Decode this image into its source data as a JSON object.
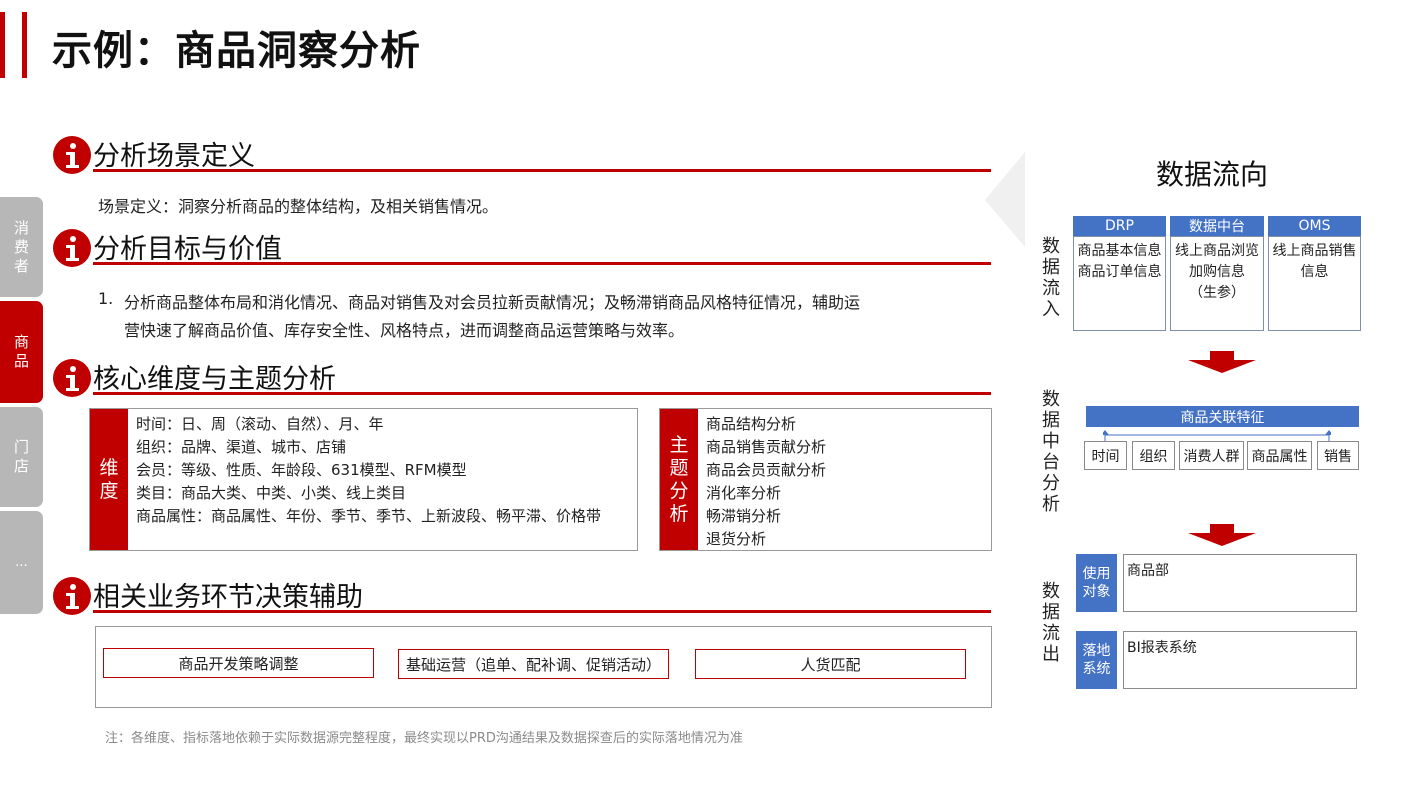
{
  "header": {
    "title": "示例：商品洞察分析"
  },
  "side_tabs": [
    "消费者",
    "商品",
    "门店",
    "..."
  ],
  "sections": {
    "scene": {
      "title": "分析场景定义",
      "text": "场景定义：洞察分析商品的整体结构，及相关销售情况。"
    },
    "goal": {
      "title": "分析目标与价值",
      "num": "1.",
      "line1": "分析商品整体布局和消化情况、商品对销售及对会员拉新贡献情况；及畅滞销商品风格特征情况，辅助运",
      "line2": "营快速了解商品价值、库存安全性、风格特点，进而调整商品运营策略与效率。"
    },
    "core": {
      "title": "核心维度与主题分析",
      "dim_label": "维度",
      "dims": [
        "时间：日、周（滚动、自然）、月、年",
        "组织：品牌、渠道、城市、店铺",
        "会员：等级、性质、年龄段、631模型、RFM模型",
        "类目：商品大类、中类、小类、线上类目",
        "商品属性：商品属性、年份、季节、季节、上新波段、畅平滞、价格带"
      ],
      "topic_label": "主题分析",
      "topics": [
        "商品结构分析",
        "商品销售贡献分析",
        "商品会员贡献分析",
        "消化率分析",
        "畅滞销分析",
        "退货分析"
      ]
    },
    "decision": {
      "title": "相关业务环节决策辅助",
      "items": [
        "商品开发策略调整",
        "基础运营（追单、配补调、促销活动）",
        "人货匹配"
      ]
    }
  },
  "note": "注：各维度、指标落地依赖于实际数据源完整程度，最终实现以PRD沟通结果及数据探查后的实际落地情况为准",
  "flow": {
    "title": "数据流向",
    "inflow_label": "数据流入",
    "sources": [
      {
        "name": "DRP",
        "lines": [
          "商品基本信息",
          "商品订单信息"
        ]
      },
      {
        "name": "数据中台",
        "lines": [
          "线上商品浏览",
          "加购信息",
          "（生参）"
        ]
      },
      {
        "name": "OMS",
        "lines": [
          "线上商品销售",
          "信息"
        ]
      }
    ],
    "mid_label": "数据中台分析",
    "feature_title": "商品关联特征",
    "features": [
      "时间",
      "组织",
      "消费人群",
      "商品属性",
      "销售"
    ],
    "outflow_label": "数据流出",
    "outputs": [
      {
        "label": "使用对象",
        "value": "商品部"
      },
      {
        "label": "落地系统",
        "value": "BI报表系统"
      }
    ]
  },
  "colors": {
    "accent": "#c00000",
    "blue": "#4472c4"
  }
}
